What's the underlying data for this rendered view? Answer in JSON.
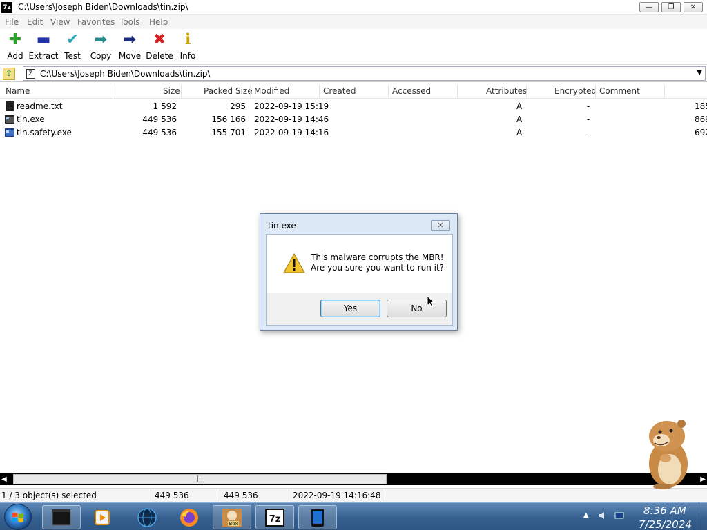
{
  "window": {
    "app_icon_text": "7z",
    "title": "C:\\Users\\Joseph Biden\\Downloads\\tin.zip\\",
    "minimize_glyph": "—",
    "maximize_glyph": "❐",
    "close_glyph": "✕"
  },
  "menu": [
    "File",
    "Edit",
    "View",
    "Favorites",
    "Tools",
    "Help"
  ],
  "toolbar": [
    {
      "label": "Add",
      "glyph": "✚",
      "color": "#2e9e2e"
    },
    {
      "label": "Extract",
      "glyph": "▬",
      "color": "#2233aa"
    },
    {
      "label": "Test",
      "glyph": "✔",
      "color": "#2aa9b9"
    },
    {
      "label": "Copy",
      "glyph": "➡",
      "color": "#2a8a8a"
    },
    {
      "label": "Move",
      "glyph": "➡",
      "color": "#1b2a7a"
    },
    {
      "label": "Delete",
      "glyph": "✖",
      "color": "#d42020"
    },
    {
      "label": "Info",
      "glyph": "ℹ",
      "color": "#c9a400"
    }
  ],
  "address": {
    "path": "C:\\Users\\Joseph Biden\\Downloads\\tin.zip\\",
    "dropdown_glyph": "▼",
    "up_glyph": "⇧",
    "zip_glyph": "Z"
  },
  "columns": [
    "Name",
    "Size",
    "Packed Size",
    "Modified",
    "Created",
    "Accessed",
    "Attributes",
    "Encrypted",
    "Comment"
  ],
  "files": [
    {
      "name": "readme.txt",
      "size": "1 592",
      "packed": "295",
      "modified": "2022-09-19 15:19",
      "attributes": "A",
      "encrypted": "-",
      "crc": "185",
      "icon": "text-file-icon"
    },
    {
      "name": "tin.exe",
      "size": "449 536",
      "packed": "156 166",
      "modified": "2022-09-19 14:46",
      "attributes": "A",
      "encrypted": "-",
      "crc": "869",
      "icon": "exe-file-icon"
    },
    {
      "name": "tin.safety.exe",
      "size": "449 536",
      "packed": "155 701",
      "modified": "2022-09-19 14:16",
      "attributes": "A",
      "encrypted": "-",
      "crc": "692",
      "icon": "exe-file-icon"
    }
  ],
  "scrollbar": {
    "left_arrow": "◀",
    "right_arrow": "▶",
    "grip": "|||"
  },
  "status": {
    "selection": "1 / 3 object(s) selected",
    "size": "449 536",
    "packed": "449 536",
    "modified": "2022-09-19 14:16:48"
  },
  "dialog": {
    "title": "tin.exe",
    "close_glyph": "✕",
    "message_line1": "This malware corrupts the MBR!",
    "message_line2": "Are you sure you want to run it?",
    "yes_label": "Yes",
    "no_label": "No"
  },
  "taskbar": {
    "apps": [
      "start-menu",
      "terminal",
      "media-player",
      "globe-browser",
      "firefox",
      "box-game",
      "7-zip",
      "tablet-app"
    ],
    "app_7z_text": "7z",
    "box_text": "Box"
  },
  "clock": {
    "time": "8:36 AM",
    "date": "7/25/2024"
  },
  "tray_arrow": "▲"
}
